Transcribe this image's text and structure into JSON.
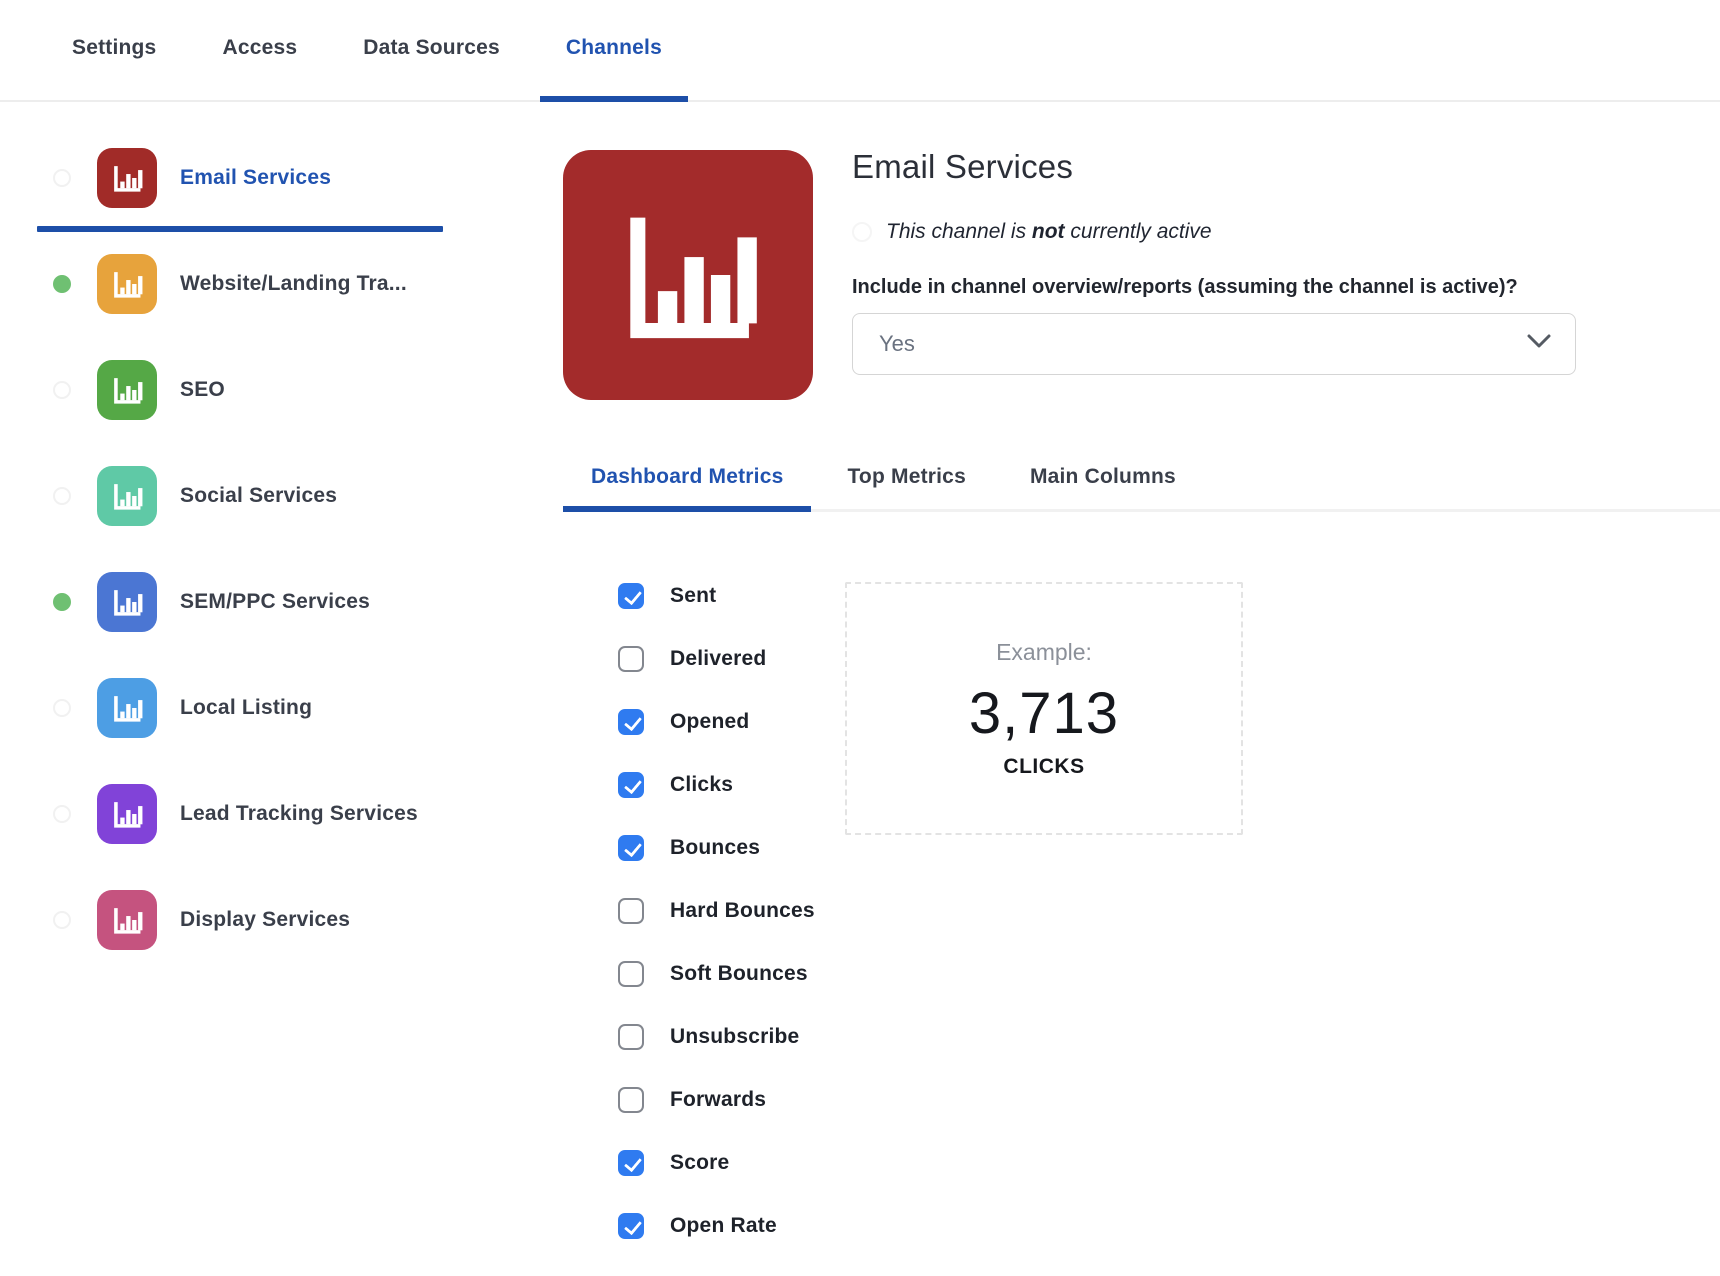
{
  "topbar": {
    "tabs": [
      {
        "label": "Settings",
        "active": false
      },
      {
        "label": "Access",
        "active": false
      },
      {
        "label": "Data Sources",
        "active": false
      },
      {
        "label": "Channels",
        "active": true
      }
    ]
  },
  "sidebar": {
    "channels": [
      {
        "label": "Email Services",
        "color": "#a12b28",
        "selected": true,
        "has_dot": false
      },
      {
        "label": "Website/Landing Tra...",
        "color": "#e7a33c",
        "selected": false,
        "has_dot": true
      },
      {
        "label": "SEO",
        "color": "#55a846",
        "selected": false,
        "has_dot": false
      },
      {
        "label": "Social Services",
        "color": "#5fc9a6",
        "selected": false,
        "has_dot": false
      },
      {
        "label": "SEM/PPC Services",
        "color": "#4b76d3",
        "selected": false,
        "has_dot": true
      },
      {
        "label": "Local Listing",
        "color": "#4d9ee4",
        "selected": false,
        "has_dot": false
      },
      {
        "label": "Lead Tracking Services",
        "color": "#8143d8",
        "selected": false,
        "has_dot": false
      },
      {
        "label": "Display Services",
        "color": "#c5537f",
        "selected": false,
        "has_dot": false
      }
    ],
    "dot_color": "#6fc072"
  },
  "detail": {
    "title": "Email Services",
    "icon_color": "#a32b2b",
    "active_note": {
      "prefix": "This channel is ",
      "bold": "not",
      "suffix": " currently active"
    },
    "include_question": "Include in channel overview/reports (assuming the channel is active)?",
    "include_value": "Yes",
    "subtabs": [
      {
        "label": "Dashboard Metrics",
        "active": true
      },
      {
        "label": "Top Metrics",
        "active": false
      },
      {
        "label": "Main Columns",
        "active": false
      }
    ],
    "metrics": [
      {
        "label": "Sent",
        "checked": true
      },
      {
        "label": "Delivered",
        "checked": false
      },
      {
        "label": "Opened",
        "checked": true
      },
      {
        "label": "Clicks",
        "checked": true
      },
      {
        "label": "Bounces",
        "checked": true
      },
      {
        "label": "Hard Bounces",
        "checked": false
      },
      {
        "label": "Soft Bounces",
        "checked": false
      },
      {
        "label": "Unsubscribe",
        "checked": false
      },
      {
        "label": "Forwards",
        "checked": false
      },
      {
        "label": "Score",
        "checked": true
      },
      {
        "label": "Open Rate",
        "checked": true
      }
    ],
    "example": {
      "heading": "Example:",
      "value": "3,713",
      "unit": "CLICKS"
    }
  },
  "colors": {
    "accent_blue": "#2153b0",
    "underline_blue": "#1d4fa8",
    "checkbox_blue": "#2f7bf0",
    "status_dot_green": "#6fc072"
  }
}
